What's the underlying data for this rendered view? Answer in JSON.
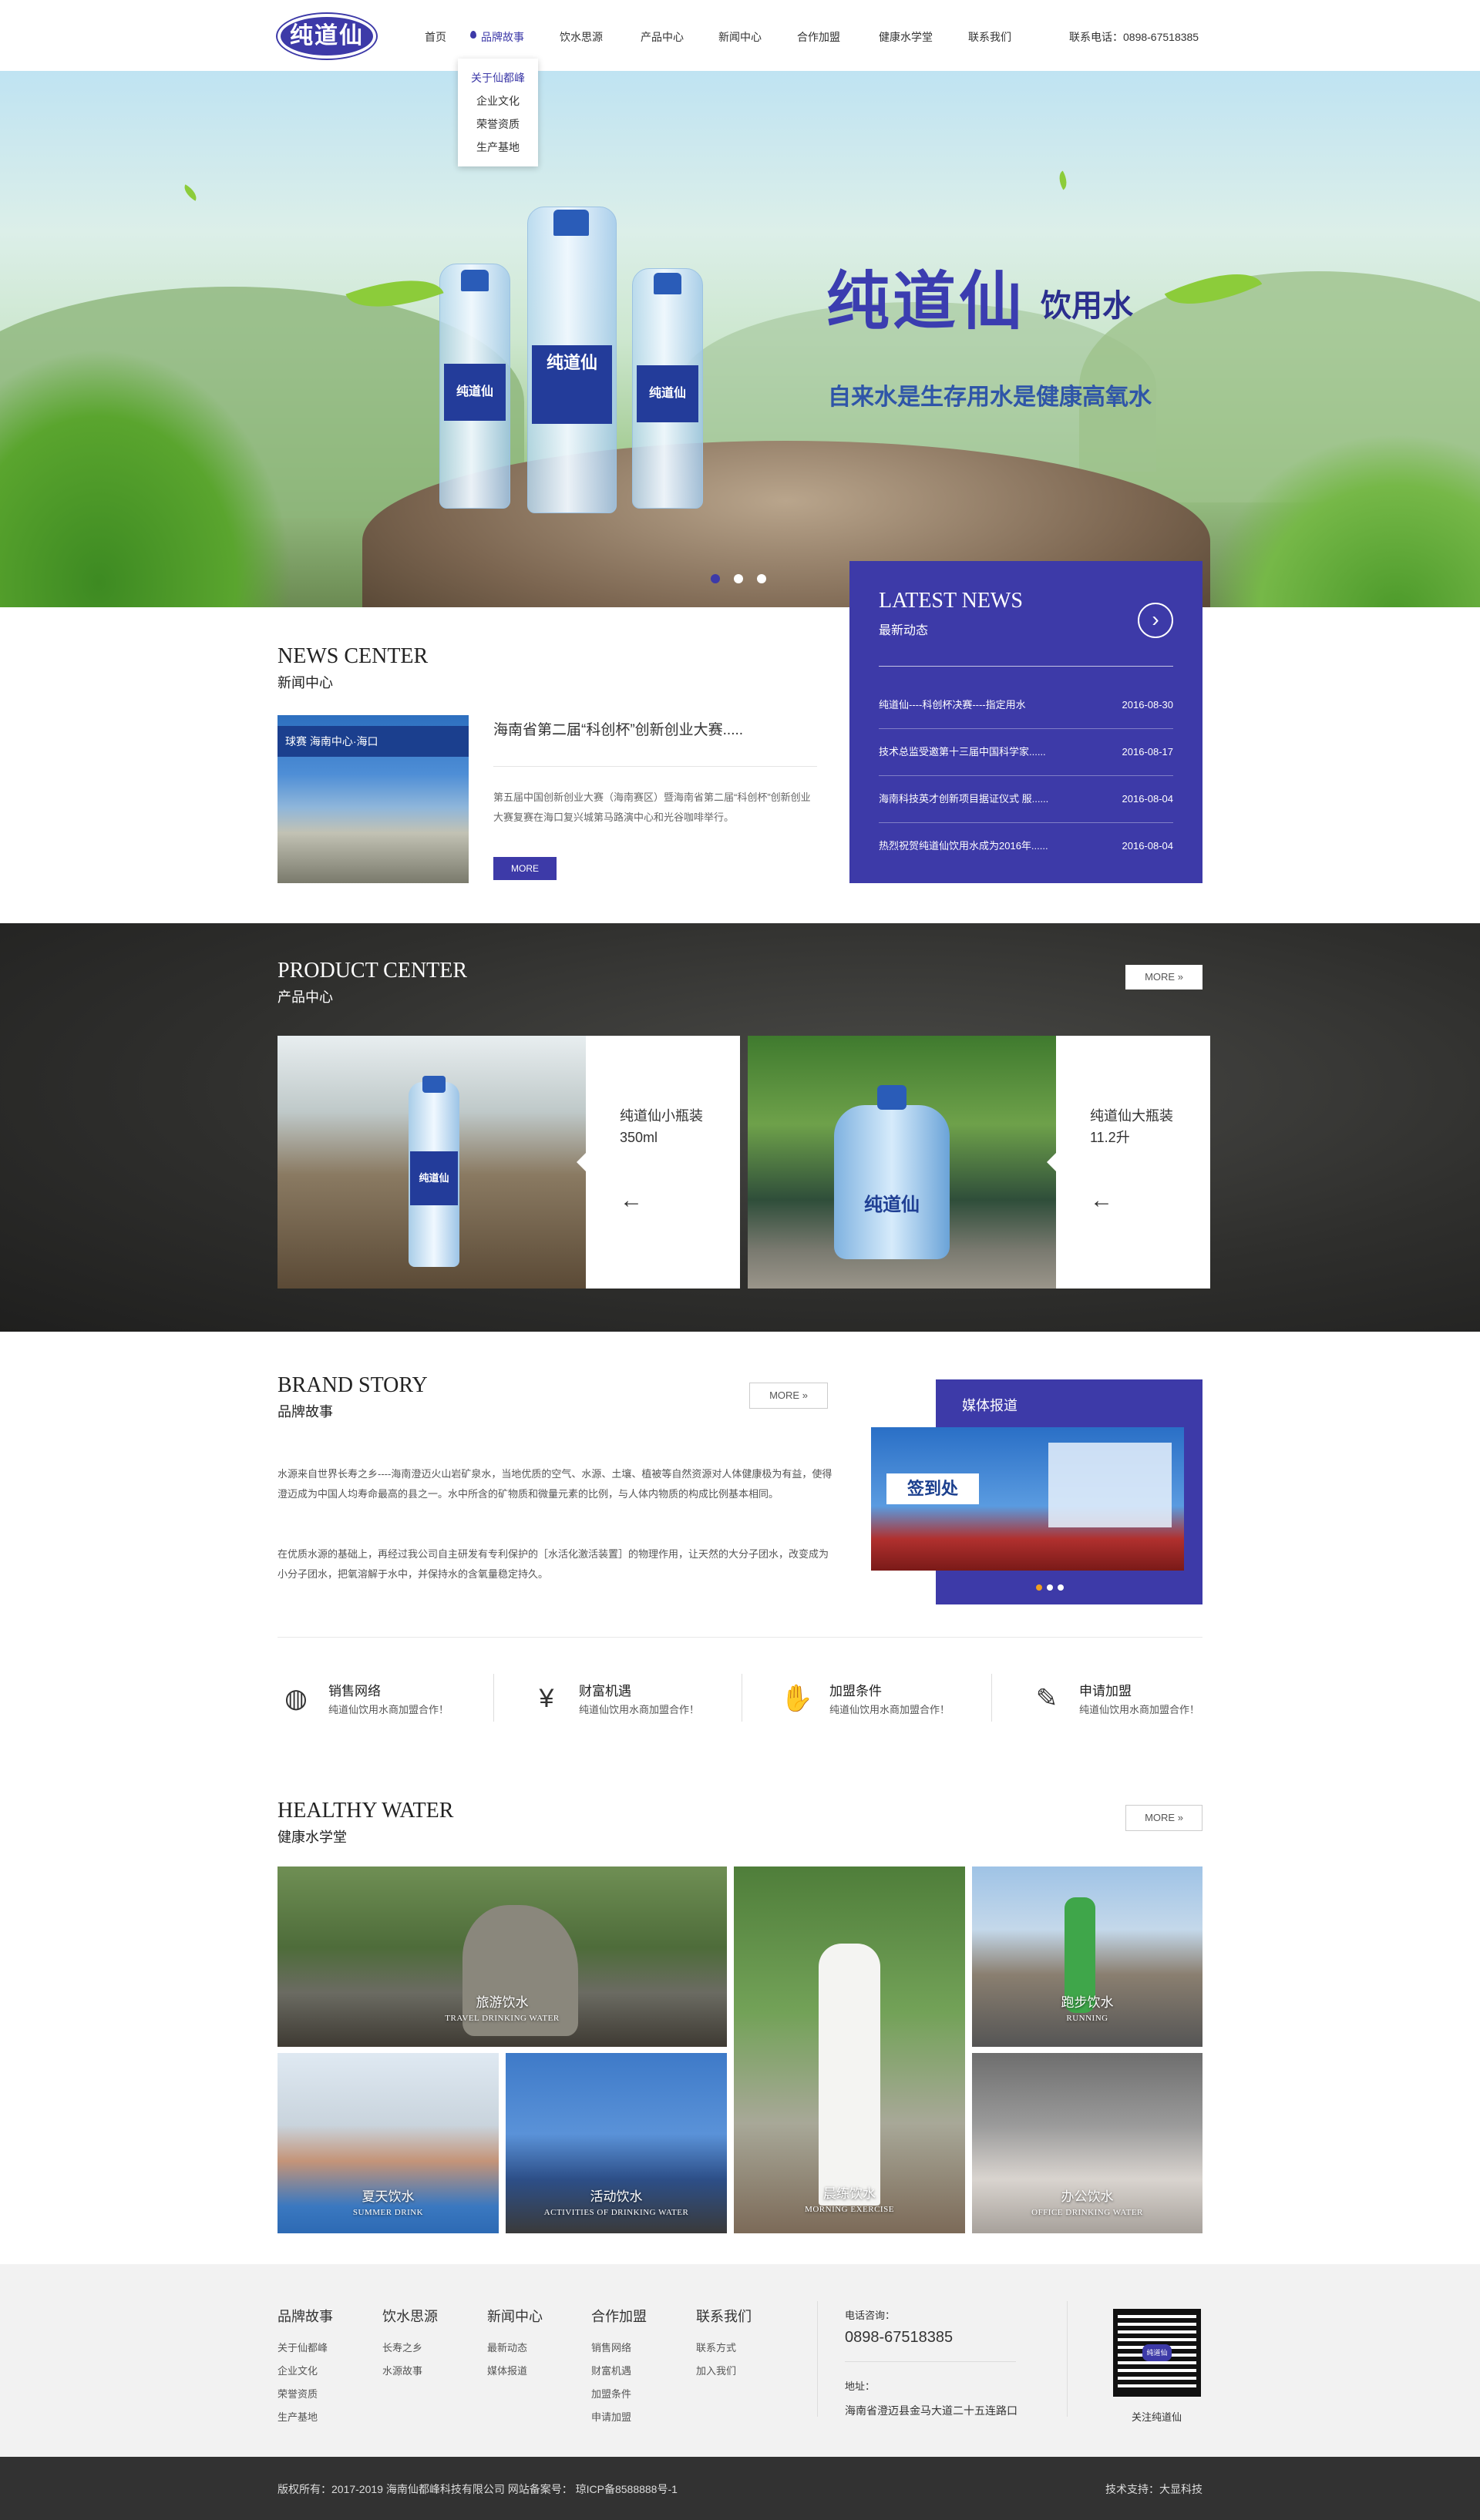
{
  "header": {
    "logo": "纯道仙",
    "nav": [
      "首页",
      "品牌故事",
      "饮水思源",
      "产品中心",
      "新闻中心",
      "合作加盟",
      "健康水学堂",
      "联系我们"
    ],
    "dropdown": [
      "关于仙都峰",
      "企业文化",
      "荣誉资质",
      "生产基地"
    ],
    "phone": "联系电话：0898-67518385"
  },
  "banner": {
    "title": "纯道仙",
    "title2": "饮用水",
    "subtitle": "自来水是生存用水是健康高氧水",
    "bottle_label": "纯道仙"
  },
  "news": {
    "title": "NEWS CENTER",
    "subtitle": "新闻中心",
    "photo_text": "球赛 海南中心·海口",
    "headline": "海南省第二届“科创杯”创新创业大赛.....",
    "summary": "第五届中国创新创业大赛（海南赛区）暨海南省第二届“科创杯”创新创业大赛复赛在海口复兴城第马路演中心和光谷咖啡举行。",
    "more": "MORE"
  },
  "latest": {
    "title": "LATEST NEWS",
    "subtitle": "最新动态",
    "items": [
      {
        "text": "纯道仙----科创杯决赛----指定用水",
        "date": "2016-08-30"
      },
      {
        "text": "技术总监受邀第十三届中国科学家......",
        "date": "2016-08-17"
      },
      {
        "text": "海南科技英才创新项目据证仪式 服......",
        "date": "2016-08-04"
      },
      {
        "text": "热烈祝贺纯道仙饮用水成为2016年......",
        "date": "2016-08-04"
      }
    ]
  },
  "products": {
    "title": "PRODUCT CENTER",
    "subtitle": "产品中心",
    "more": "MORE",
    "items": [
      {
        "name": "纯道仙小瓶装",
        "spec": "350ml"
      },
      {
        "name": "纯道仙大瓶装",
        "spec": "11.2升"
      }
    ]
  },
  "brand": {
    "title": "BRAND STORY",
    "subtitle": "品牌故事",
    "more": "MORE",
    "p1": "水源来自世界长寿之乡----海南澄迈火山岩矿泉水，当地优质的空气、水源、土壤、植被等自然资源对人体健康极为有益，使得澄迈成为中国人均寿命最高的县之一。水中所含的矿物质和微量元素的比例，与人体内物质的构成比例基本相同。",
    "p2": "在优质水源的基础上，再经过我公司自主研发有专利保护的［水活化激活装置］的物理作用，让天然的大分子团水，改变成为小分子团水，把氧溶解于水中，并保持水的含氧量稳定持久。",
    "media_title": "媒体报道",
    "media_text": "签到处"
  },
  "features": [
    {
      "title": "销售网络",
      "desc": "纯道仙饮用水商加盟合作！",
      "icon": "globe-icon",
      "glyph": "◍"
    },
    {
      "title": "财富机遇",
      "desc": "纯道仙饮用水商加盟合作！",
      "icon": "money-bag-icon",
      "glyph": "¥"
    },
    {
      "title": "加盟条件",
      "desc": "纯道仙饮用水商加盟合作！",
      "icon": "handshake-icon",
      "glyph": "✋"
    },
    {
      "title": "申请加盟",
      "desc": "纯道仙饮用水商加盟合作！",
      "icon": "form-edit-icon",
      "glyph": "✎"
    }
  ],
  "healthy": {
    "title": "HEALTHY WATER",
    "subtitle": "健康水学堂",
    "more": "MORE",
    "tiles": [
      {
        "cn": "旅游饮水",
        "en": "TRAVEL DRINKING WATER"
      },
      {
        "cn": "晨练饮水",
        "en": "MORNING EXERCISE"
      },
      {
        "cn": "跑步饮水",
        "en": "RUNNING"
      },
      {
        "cn": "夏天饮水",
        "en": "SUMMER DRINK"
      },
      {
        "cn": "活动饮水",
        "en": "ACTIVITIES OF DRINKING WATER"
      },
      {
        "cn": "办公饮水",
        "en": "OFFICE DRINKING WATER"
      }
    ]
  },
  "footer": {
    "cols": [
      {
        "head": "品牌故事",
        "items": [
          "关于仙都峰",
          "企业文化",
          "荣誉资质",
          "生产基地"
        ]
      },
      {
        "head": "饮水思源",
        "items": [
          "长寿之乡",
          "水源故事"
        ]
      },
      {
        "head": "新闻中心",
        "items": [
          "最新动态",
          "媒体报道"
        ]
      },
      {
        "head": "合作加盟",
        "items": [
          "销售网络",
          "财富机遇",
          "加盟条件",
          "申请加盟"
        ]
      },
      {
        "head": "联系我们",
        "items": [
          "联系方式",
          "加入我们"
        ]
      }
    ],
    "phone_label": "电话咨询：",
    "phone": "0898-67518385",
    "addr_label": "地址：",
    "addr": "海南省澄迈县金马大道二十五连路口",
    "qr_center": "纯道仙",
    "qr_caption": "关注纯道仙",
    "copyright": "版权所有：2017-2019 海南仙都峰科技有限公司    网站备案号： 琼ICP备8588888号-1",
    "support": "技术支持：大显科技"
  },
  "colors": {
    "brand": "#3d3aa8",
    "dark": "#323232",
    "footer_bg": "#f2f2f2"
  }
}
